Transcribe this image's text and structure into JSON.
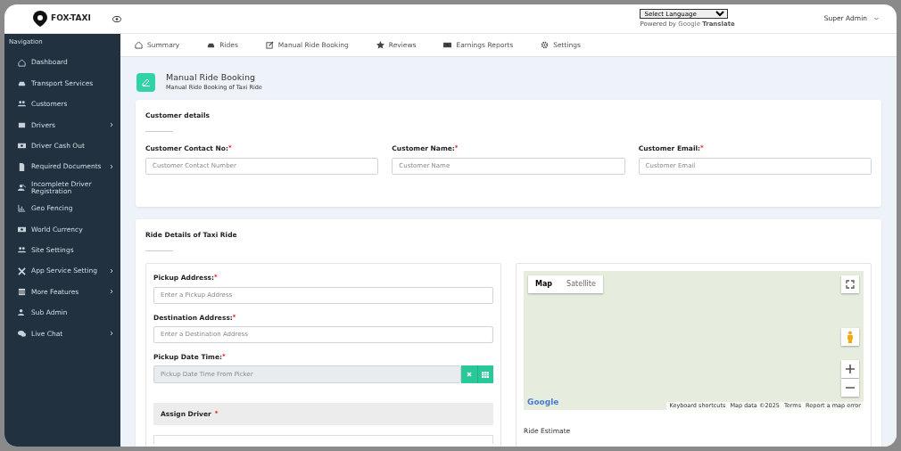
{
  "header": {
    "brand": "FOX-TAXI",
    "language_select": {
      "value": "Select Language"
    },
    "powered_by": "Powered by",
    "translate_logo": "Google",
    "translate_word": "Translate",
    "user": "Super Admin"
  },
  "sidebar": {
    "heading": "Navigation",
    "items": [
      {
        "label": "Dashboard",
        "has_submenu": false
      },
      {
        "label": "Transport Services",
        "has_submenu": false
      },
      {
        "label": "Customers",
        "has_submenu": false
      },
      {
        "label": "Drivers",
        "has_submenu": true
      },
      {
        "label": "Driver Cash Out",
        "has_submenu": false
      },
      {
        "label": "Required Documents",
        "has_submenu": true
      },
      {
        "label": "Incomplete Driver Registration",
        "has_submenu": false
      },
      {
        "label": "Geo Fencing",
        "has_submenu": false
      },
      {
        "label": "World Currency",
        "has_submenu": false
      },
      {
        "label": "Site Settings",
        "has_submenu": false
      },
      {
        "label": "App Service Setting",
        "has_submenu": true
      },
      {
        "label": "More Features",
        "has_submenu": true
      },
      {
        "label": "Sub Admin",
        "has_submenu": false
      },
      {
        "label": "Live Chat",
        "has_submenu": true
      }
    ]
  },
  "tabs": [
    {
      "label": "Summary"
    },
    {
      "label": "Rides"
    },
    {
      "label": "Manual Ride Booking"
    },
    {
      "label": "Reviews"
    },
    {
      "label": "Earnings Reports"
    },
    {
      "label": "Settings"
    }
  ],
  "page": {
    "title": "Manual Ride Booking",
    "subtitle": "Manual Ride Booking of Taxi Ride"
  },
  "customer_card": {
    "title": "Customer details",
    "fields": [
      {
        "label": "Customer Contact No:",
        "required_mark": "*",
        "placeholder": "Customer Contact Number"
      },
      {
        "label": "Customer Name:",
        "required_mark": "*",
        "placeholder": "Customer Name"
      },
      {
        "label": "Customer Email:",
        "required_mark": "*",
        "placeholder": "Customer Email"
      }
    ]
  },
  "ride_card": {
    "title": "Ride Details of Taxi Ride",
    "fields": [
      {
        "kind": "text",
        "label": "Pickup Address:",
        "required_mark": "*",
        "placeholder": "Enter a Pickup Address"
      },
      {
        "kind": "text",
        "label": "Destination Address:",
        "required_mark": "*",
        "placeholder": "Enter a Destination Address"
      },
      {
        "kind": "datetime",
        "label": "Pickup Date Time:",
        "required_mark": "*",
        "placeholder": "Pickup Date Time From Picker"
      }
    ],
    "assign_driver": {
      "label": "Assign Driver",
      "required_mark": "*"
    },
    "map": {
      "types": [
        {
          "label": "Map",
          "selected": true
        },
        {
          "label": "Satellite",
          "selected": false
        }
      ],
      "logo": "Google",
      "attribution": [
        "Keyboard shortcuts",
        "Map data ©2025",
        "Terms",
        "Report a map error"
      ]
    },
    "estimate_title": "Ride Estimate"
  }
}
